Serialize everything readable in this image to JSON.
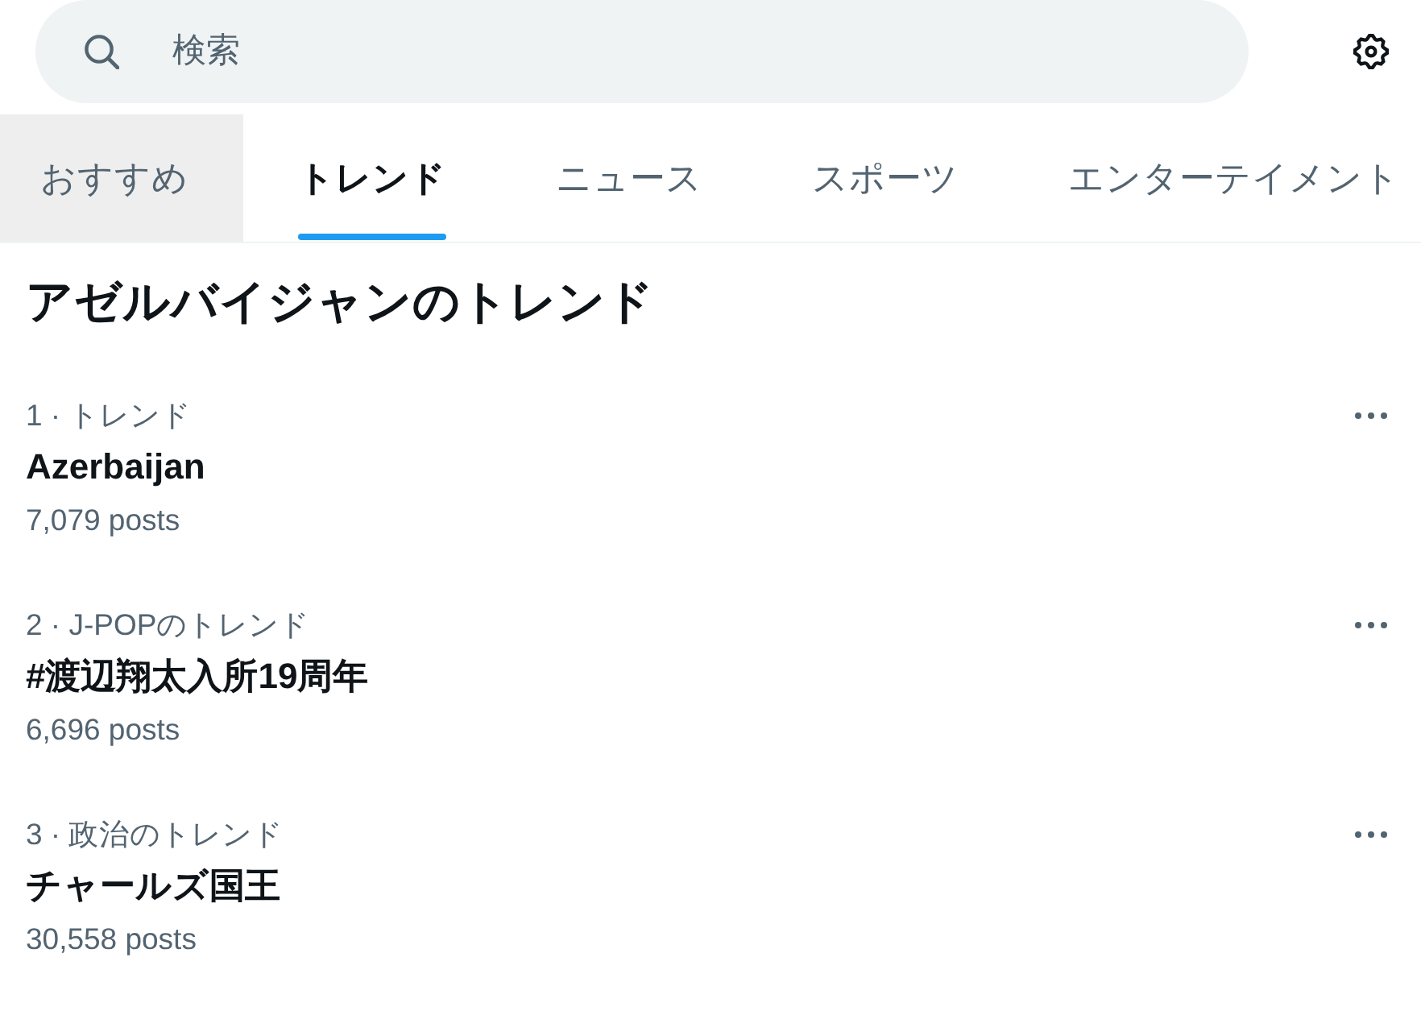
{
  "search": {
    "placeholder": "検索"
  },
  "tabs": [
    {
      "label": "おすすめ",
      "selected": false,
      "hovered": true
    },
    {
      "label": "トレンド",
      "selected": true,
      "hovered": false
    },
    {
      "label": "ニュース",
      "selected": false,
      "hovered": false
    },
    {
      "label": "スポーツ",
      "selected": false,
      "hovered": false
    },
    {
      "label": "エンターテイメント",
      "selected": false,
      "hovered": false
    }
  ],
  "trends_title": "アゼルバイジャンのトレンド",
  "trends": [
    {
      "context": "1 · トレンド",
      "name": "Azerbaijan",
      "posts": "7,079 posts"
    },
    {
      "context": "2 · J-POPのトレンド",
      "name": "#渡辺翔太入所19周年",
      "posts": "6,696 posts"
    },
    {
      "context": "3 · 政治のトレンド",
      "name": "チャールズ国王",
      "posts": "30,558 posts"
    }
  ]
}
